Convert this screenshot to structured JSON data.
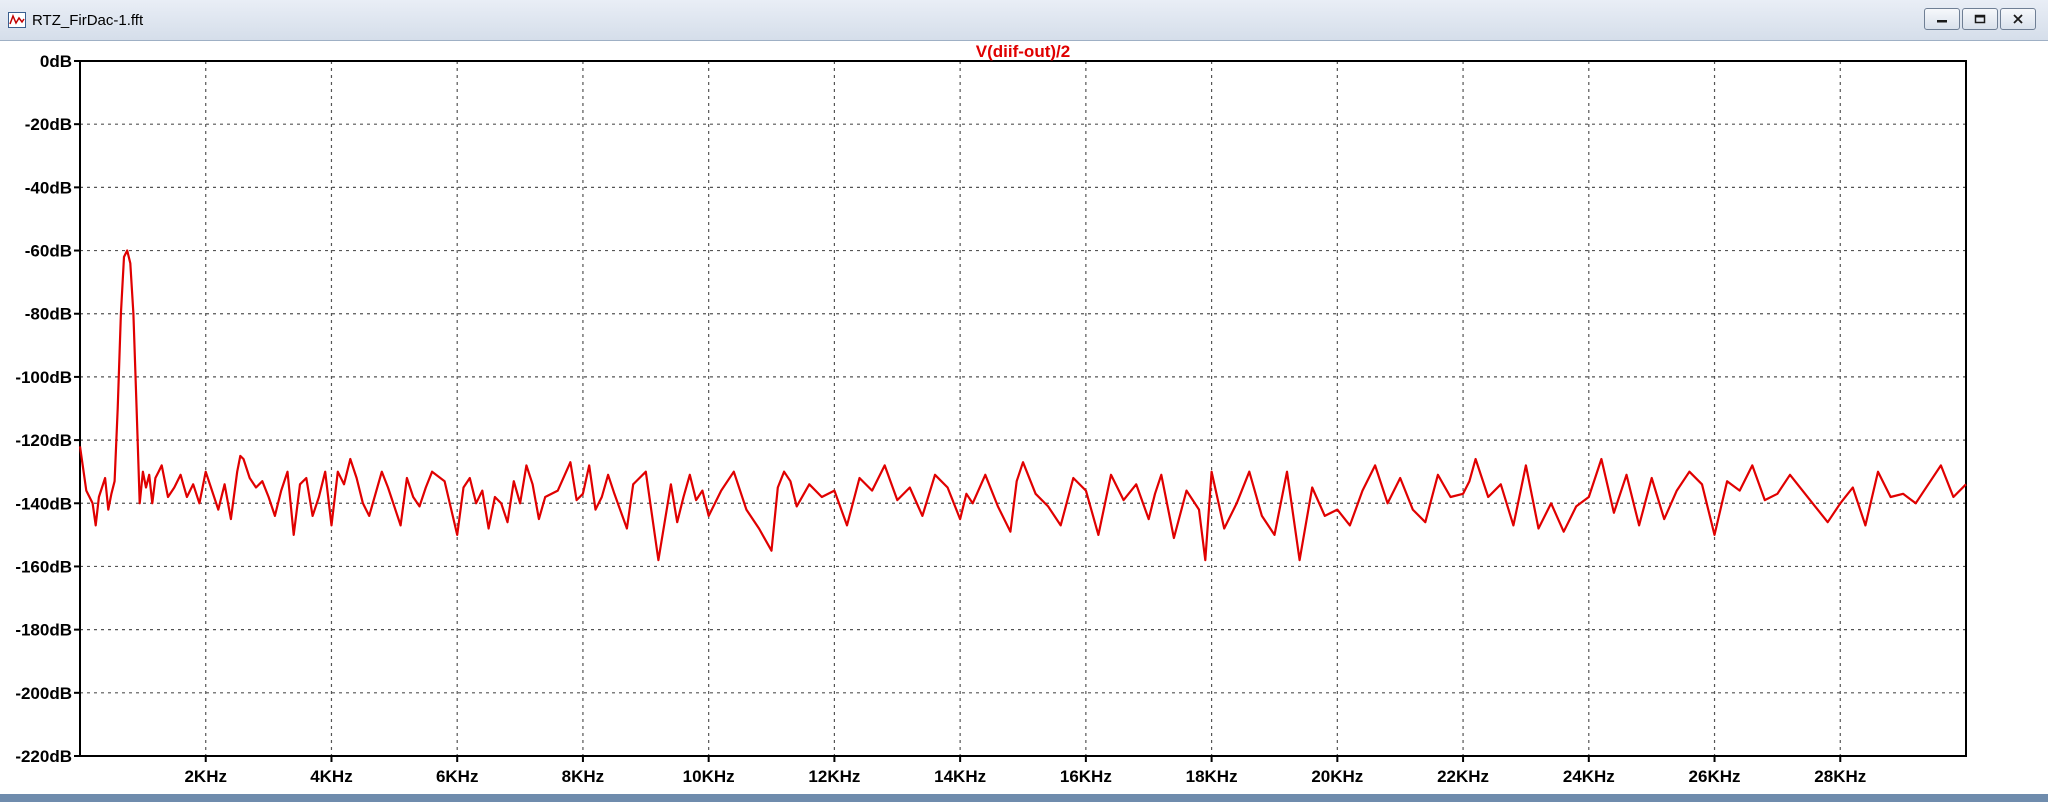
{
  "window": {
    "title": "RTZ_FirDac-1.fft",
    "minimize_label": "minimize",
    "maximize_label": "maximize",
    "close_label": "close"
  },
  "colors": {
    "trace": "#e00000",
    "axis": "#000000",
    "grid": "#555555",
    "frame": "#4a86c7"
  },
  "chart_data": {
    "type": "line",
    "title": "V(diif-out)/2",
    "xlabel": "",
    "ylabel": "",
    "xlim": [
      0,
      30000
    ],
    "ylim": [
      -220,
      0
    ],
    "grid": true,
    "x_ticks": [
      2000,
      4000,
      6000,
      8000,
      10000,
      12000,
      14000,
      16000,
      18000,
      20000,
      22000,
      24000,
      26000,
      28000
    ],
    "x_tick_labels": [
      "2KHz",
      "4KHz",
      "6KHz",
      "8KHz",
      "10KHz",
      "12KHz",
      "14KHz",
      "16KHz",
      "18KHz",
      "20KHz",
      "22KHz",
      "24KHz",
      "26KHz",
      "28KHz"
    ],
    "y_ticks": [
      0,
      -20,
      -40,
      -60,
      -80,
      -100,
      -120,
      -140,
      -160,
      -180,
      -200,
      -220
    ],
    "y_tick_labels": [
      "0dB",
      "-20dB",
      "-40dB",
      "-60dB",
      "-80dB",
      "-100dB",
      "-120dB",
      "-140dB",
      "-160dB",
      "-180dB",
      "-200dB",
      "-220dB"
    ],
    "series": [
      {
        "values_x": [
          0,
          100,
          200,
          250,
          300,
          400,
          450,
          500,
          550,
          600,
          650,
          700,
          750,
          800,
          850,
          900,
          950,
          1000,
          1050,
          1100,
          1150,
          1200,
          1250,
          1300,
          1400,
          1500,
          1600,
          1700,
          1800,
          1900,
          2000,
          2100,
          2200,
          2300,
          2400,
          2500,
          2550,
          2600,
          2700,
          2800,
          2900,
          3000,
          3100,
          3150,
          3200,
          3300,
          3400,
          3500,
          3600,
          3700,
          3800,
          3900,
          4000,
          4100,
          4200,
          4300,
          4400,
          4500,
          4600,
          4700,
          4800,
          4900,
          5000,
          5100,
          5200,
          5300,
          5400,
          5500,
          5600,
          5800,
          6000,
          6100,
          6200,
          6300,
          6400,
          6500,
          6600,
          6700,
          6800,
          6900,
          7000,
          7100,
          7200,
          7300,
          7400,
          7600,
          7800,
          7900,
          8000,
          8100,
          8200,
          8300,
          8400,
          8500,
          8700,
          8800,
          9000,
          9200,
          9400,
          9500,
          9600,
          9700,
          9800,
          9900,
          10000,
          10200,
          10400,
          10600,
          10800,
          11000,
          11100,
          11200,
          11300,
          11400,
          11600,
          11800,
          12000,
          12200,
          12400,
          12600,
          12800,
          13000,
          13200,
          13400,
          13600,
          13800,
          14000,
          14100,
          14200,
          14400,
          14600,
          14800,
          14900,
          15000,
          15200,
          15400,
          15600,
          15800,
          16000,
          16200,
          16400,
          16600,
          16800,
          17000,
          17100,
          17200,
          17400,
          17600,
          17800,
          17900,
          18000,
          18200,
          18400,
          18600,
          18800,
          19000,
          19200,
          19400,
          19600,
          19800,
          20000,
          20200,
          20400,
          20600,
          20800,
          21000,
          21200,
          21400,
          21600,
          21800,
          22000,
          22100,
          22200,
          22400,
          22600,
          22800,
          23000,
          23200,
          23400,
          23600,
          23800,
          24000,
          24200,
          24400,
          24600,
          24800,
          25000,
          25200,
          25400,
          25600,
          25800,
          26000,
          26200,
          26400,
          26600,
          26800,
          27000,
          27200,
          27400,
          27600,
          27800,
          28000,
          28200,
          28400,
          28600,
          28800,
          29000,
          29200,
          29400,
          29600,
          29800,
          30000
        ],
        "values_y": [
          -122,
          -136,
          -140,
          -147,
          -138,
          -132,
          -142,
          -137,
          -133,
          -110,
          -80,
          -62,
          -60,
          -64,
          -80,
          -110,
          -140,
          -130,
          -135,
          -131,
          -140,
          -132,
          -130,
          -128,
          -138,
          -135,
          -131,
          -138,
          -134,
          -140,
          -130,
          -136,
          -142,
          -134,
          -145,
          -130,
          -125,
          -126,
          -132,
          -135,
          -133,
          -138,
          -144,
          -140,
          -136,
          -130,
          -150,
          -134,
          -132,
          -144,
          -138,
          -130,
          -147,
          -130,
          -134,
          -126,
          -132,
          -140,
          -144,
          -137,
          -130,
          -135,
          -141,
          -147,
          -132,
          -138,
          -141,
          -135,
          -130,
          -133,
          -150,
          -135,
          -132,
          -140,
          -136,
          -148,
          -138,
          -140,
          -146,
          -133,
          -140,
          -128,
          -134,
          -145,
          -138,
          -136,
          -127,
          -139,
          -137,
          -128,
          -142,
          -138,
          -131,
          -137,
          -148,
          -134,
          -130,
          -158,
          -134,
          -146,
          -138,
          -131,
          -139,
          -136,
          -144,
          -136,
          -130,
          -142,
          -148,
          -155,
          -135,
          -130,
          -133,
          -141,
          -134,
          -138,
          -136,
          -147,
          -132,
          -136,
          -128,
          -139,
          -135,
          -144,
          -131,
          -135,
          -145,
          -137,
          -140,
          -131,
          -141,
          -149,
          -133,
          -127,
          -137,
          -141,
          -147,
          -132,
          -136,
          -150,
          -131,
          -139,
          -134,
          -145,
          -137,
          -131,
          -151,
          -136,
          -142,
          -158,
          -130,
          -148,
          -140,
          -130,
          -144,
          -150,
          -130,
          -158,
          -135,
          -144,
          -142,
          -147,
          -136,
          -128,
          -140,
          -132,
          -142,
          -146,
          -131,
          -138,
          -137,
          -133,
          -126,
          -138,
          -134,
          -147,
          -128,
          -148,
          -140,
          -149,
          -141,
          -138,
          -126,
          -143,
          -131,
          -147,
          -132,
          -145,
          -136,
          -130,
          -134,
          -150,
          -133,
          -136,
          -128,
          -139,
          -137,
          -131,
          -136,
          -141,
          -146,
          -140,
          -135,
          -147,
          -130,
          -138,
          -137,
          -140,
          -134,
          -128,
          -138,
          -134,
          -126,
          -131,
          -141,
          -130,
          -137,
          -142
        ]
      }
    ]
  }
}
